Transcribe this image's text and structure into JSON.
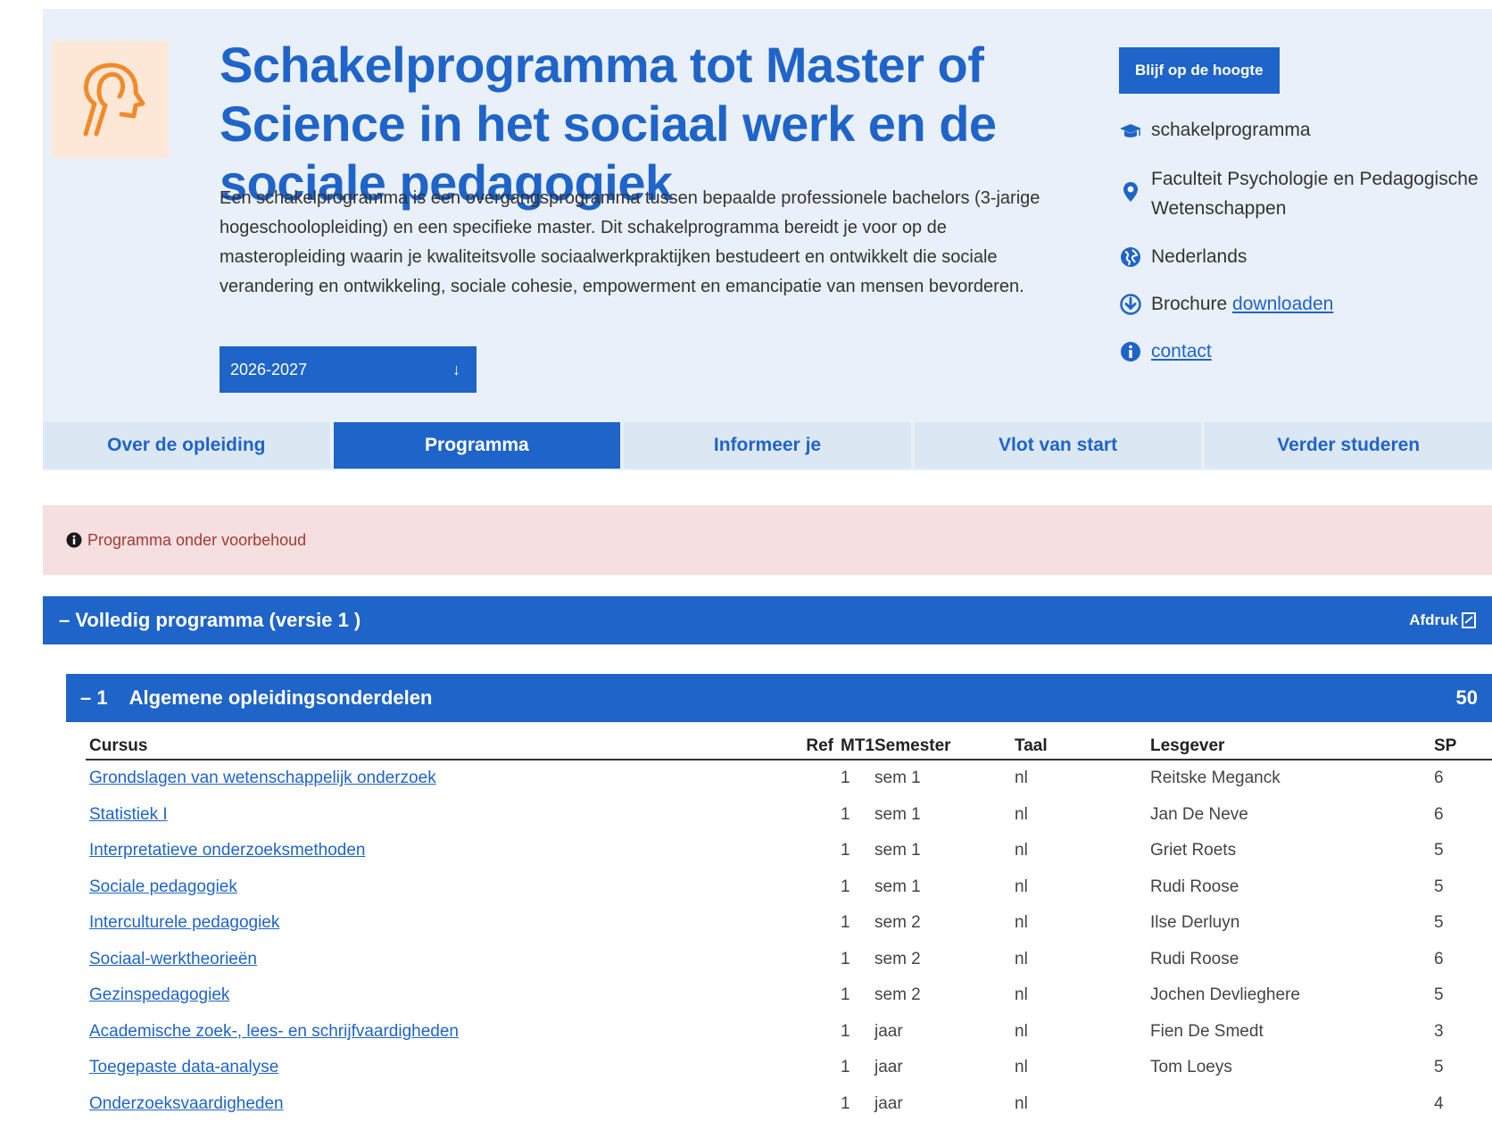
{
  "header": {
    "title": "Schakelprogramma tot Master of Science in het sociaal werk en de sociale pedagogiek",
    "intro": "Een schakelprogramma is een overgangsprogramma tussen bepaalde professionele bachelors (3-jarige hogeschoolopleiding) en een specifieke master. Dit schakelprogramma bereidt je voor op de masteropleiding waarin je kwaliteitsvolle sociaalwerkpraktijken bestudeert en ontwikkelt die sociale verandering en ontwikkeling, sociale cohesie, empowerment en emancipatie van mensen bevorderen.",
    "year_select": "2026-2027",
    "year_arrow": "↓"
  },
  "sidebar": {
    "button": "Blijf op de hoogte",
    "type": "schakelprogramma",
    "faculty": "Faculteit Psychologie en Pedagogische Wetenschappen",
    "language": "Nederlands",
    "brochure_prefix": "Brochure ",
    "brochure_link": "downloaden",
    "contact": "contact"
  },
  "tabs": [
    "Over de opleiding",
    "Programma",
    "Informeer je",
    "Vlot van start",
    "Verder studeren"
  ],
  "notice": "Programma onder voorbehoud",
  "program": {
    "title": "– Volledig programma (versie 1 )",
    "print": "Afdruk"
  },
  "section": {
    "toggle": "– 1",
    "title": "Algemene opleidingsonderdelen",
    "sp": "50"
  },
  "table": {
    "headers": [
      "Cursus",
      "Ref",
      "MT1",
      "Semester",
      "Taal",
      "Lesgever",
      "SP"
    ],
    "rows": [
      {
        "cursus": "Grondslagen van wetenschappelijk onderzoek",
        "mt1": "1",
        "semester": "sem 1",
        "taal": "nl",
        "lesgever": "Reitske Meganck",
        "sp": "6"
      },
      {
        "cursus": "Statistiek I",
        "mt1": "1",
        "semester": "sem 1",
        "taal": "nl",
        "lesgever": "Jan De Neve",
        "sp": "6"
      },
      {
        "cursus": "Interpretatieve onderzoeksmethoden",
        "mt1": "1",
        "semester": "sem 1",
        "taal": "nl",
        "lesgever": "Griet Roets",
        "sp": "5"
      },
      {
        "cursus": "Sociale pedagogiek",
        "mt1": "1",
        "semester": "sem 1",
        "taal": "nl",
        "lesgever": "Rudi Roose",
        "sp": "5"
      },
      {
        "cursus": "Interculturele pedagogiek",
        "mt1": "1",
        "semester": "sem 2",
        "taal": "nl",
        "lesgever": "Ilse Derluyn",
        "sp": "5"
      },
      {
        "cursus": "Sociaal-werktheorieën",
        "mt1": "1",
        "semester": "sem 2",
        "taal": "nl",
        "lesgever": "Rudi Roose",
        "sp": "6"
      },
      {
        "cursus": "Gezinspedagogiek",
        "mt1": "1",
        "semester": "sem 2",
        "taal": "nl",
        "lesgever": "Jochen Devlieghere",
        "sp": "5"
      },
      {
        "cursus": "Academische zoek-, lees- en schrijfvaardigheden",
        "mt1": "1",
        "semester": "jaar",
        "taal": "nl",
        "lesgever": "Fien De Smedt",
        "sp": "3"
      },
      {
        "cursus": "Toegepaste data-analyse",
        "mt1": "1",
        "semester": "jaar",
        "taal": "nl",
        "lesgever": "Tom Loeys",
        "sp": "5"
      },
      {
        "cursus": "Onderzoeksvaardigheden",
        "mt1": "1",
        "semester": "jaar",
        "taal": "nl",
        "lesgever": "",
        "sp": "4"
      }
    ]
  },
  "colors": {
    "accent": "#1f64c8",
    "hero_bg": "#e9f0f9",
    "notice_bg": "#f5dfe1",
    "notice_text": "#a33b32",
    "logo_bg": "#fde8d8",
    "logo_stroke": "#f28a2a"
  },
  "icons": {
    "logo": "head-profile-icon",
    "type": "graduation-cap-icon",
    "faculty": "map-pin-icon",
    "language": "globe-icon",
    "brochure": "download-circle-icon",
    "contact": "info-circle-icon",
    "notice": "info-circle-icon",
    "print": "print-icon"
  }
}
